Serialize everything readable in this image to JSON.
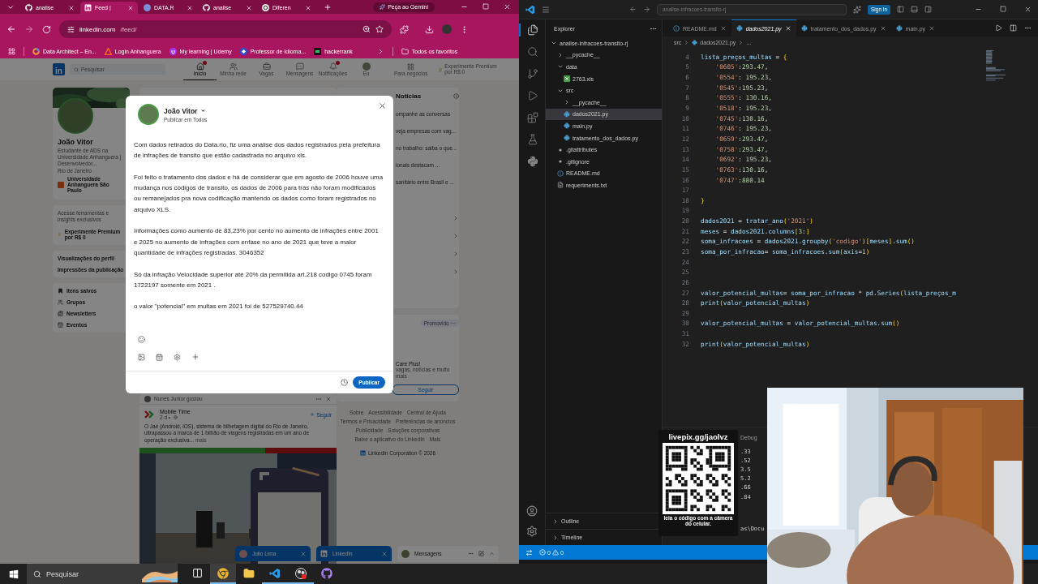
{
  "browser": {
    "tabs": [
      {
        "label": "analise",
        "kind": "github",
        "selected": false
      },
      {
        "label": "Feed |",
        "kind": "linkedin",
        "selected": true
      },
      {
        "label": "DATA.R",
        "kind": "data",
        "selected": false
      },
      {
        "label": "analise",
        "kind": "github",
        "selected": false
      },
      {
        "label": "Diferen",
        "kind": "chat",
        "selected": false
      }
    ],
    "gemini": "Peça ao Gemini",
    "url": {
      "host": "linkedin.com",
      "path": "/feed/"
    },
    "bookmarks": [
      {
        "label": "Data Architect – En...",
        "kind": "ring"
      },
      {
        "label": "Login Anhanguera",
        "kind": "triangle"
      },
      {
        "label": "My learning | Udemy",
        "kind": "badge"
      },
      {
        "label": "Professor de Idioma...",
        "kind": "diamond"
      },
      {
        "label": "hackerrank",
        "kind": "square"
      }
    ],
    "all_bookmarks": "Todos os favoritos"
  },
  "linkedin": {
    "logo": "in",
    "search": {
      "placeholder": "Pesquisar"
    },
    "nav": [
      {
        "label": "Início",
        "kind": "home",
        "selected": true,
        "alert": true
      },
      {
        "label": "Minha rede",
        "kind": "network",
        "selected": false,
        "alert": false
      },
      {
        "label": "Vagas",
        "kind": "jobs",
        "selected": false,
        "alert": false
      },
      {
        "label": "Mensagens",
        "kind": "messaging",
        "selected": false,
        "alert": false
      },
      {
        "label": "Notificações",
        "kind": "notifications",
        "selected": false,
        "alert": true
      },
      {
        "label": "Eu",
        "kind": "me",
        "selected": false,
        "alert": false
      }
    ],
    "business": "Para negócios",
    "premium_link": "Experimente Premium por R$ 0",
    "profile": {
      "name": "João Vitor",
      "headline": "Estudante de ADS na Universidade Anhanguera | Desenvolvedor...",
      "location": "Rio de Janeiro",
      "school": "Universidade Anhanguera São Paulo"
    },
    "premium_card": {
      "note": "Acesse ferramentas e insights exclusivos",
      "offer": "Experimente Premium por R$ 0"
    },
    "stats": [
      "Visualizações do perfil",
      "Impressões da publicação"
    ],
    "shortcuts": [
      {
        "label": "Itens salvos",
        "kind": "bookmark"
      },
      {
        "label": "Grupos",
        "kind": "groups"
      },
      {
        "label": "Newsletters",
        "kind": "newsletter"
      },
      {
        "label": "Eventos",
        "kind": "calendar"
      }
    ],
    "news": {
      "title": "Notícias",
      "items": [
        "ompanhe as conversas",
        "veja empresas com vag...",
        "no trabalho: saiba o que...",
        "ionais destacam ...",
        "sanitário entre Brasil e ..."
      ]
    },
    "ad": {
      "label": "Promovido ···",
      "title": "Care Plus!",
      "text": "vagas, notícias e muito mais",
      "button": "Seguir"
    },
    "footer": [
      "Sobre",
      "Acessibilidade",
      "Central de Ajuda",
      "Termos e Privacidade",
      "Preferências de anúncios",
      "Publicidade",
      "Soluções corporativas",
      "Baixe o aplicativo do LinkedIn",
      "Mais"
    ],
    "copyright": "LinkedIn Corporation © 2026",
    "post": {
      "activity": "Nunes Junior gostou",
      "author": "Mobile Time",
      "age": "2 d •",
      "follow": "Seguir",
      "text": "O Jaé (Android, iOS), sistema de bilhetagem digital do Rio de Janeiro, ultrapassou a marca de 1 bilhão de viagens registradas em um ano de operação exclusiva...",
      "more": "mais"
    },
    "chats": [
      {
        "name": "Julio Lima",
        "kind": "person"
      },
      {
        "name": "LinkedIn",
        "kind": "page"
      }
    ],
    "messaging": "Mensagens"
  },
  "dialog": {
    "author": "João Vitor",
    "audience": "Publicar em Todos",
    "paragraphs": [
      "Com dados retirados do Data.rio, fiz uma análise dos dados registrados pela prefeitura de infrações de transito que estão cadastrada no arquivo xls.",
      "Foi feito o tratamento dos dados e há de considerar que em agosto de 2006 houve uma mudança nos códigos de transito, os dados de 2006 para trás não foram modificados ou remanejados pra nova codificação mantendo os dados como foram registrados no arquivo XLS.",
      "Informações como aumento de 83,23% por cento no aumento  de infrações entre 2001 e 2025 no aumento de infrações com enfase no ano de 2021 que teve a maior quantidade de infrações registradas. 3046352",
      "Só da infração Velocidade superior até 20% da permitida art.218 codigo 0745 foram 1722197 somente em 2021 .",
      "o valor \"potencial\" em multas em 2021 foi de 527529740.44"
    ],
    "publish": "Publicar"
  },
  "vscode": {
    "title": "analise-infracoes-transito-rj",
    "sign_in": "Sign In",
    "activity": [
      {
        "kind": "explorer",
        "selected": true
      },
      {
        "kind": "search",
        "selected": false
      },
      {
        "kind": "scm",
        "selected": false
      },
      {
        "kind": "run",
        "selected": false
      },
      {
        "kind": "extensions",
        "selected": false
      },
      {
        "kind": "testing",
        "selected": false
      },
      {
        "kind": "python",
        "selected": false
      }
    ],
    "explorer": {
      "title": "Explorer",
      "tree": [
        {
          "label": "analise-infracoes-transito-rj",
          "kind": "folder",
          "expanded": true,
          "selected": false,
          "children": [
            {
              "label": "__pycache__",
              "kind": "folder",
              "expanded": false,
              "selected": false
            },
            {
              "label": "data",
              "kind": "folder",
              "expanded": true,
              "selected": false,
              "children": [
                {
                  "label": "2763.xls",
                  "kind": "excel",
                  "selected": false
                }
              ]
            },
            {
              "label": "src",
              "kind": "folder",
              "expanded": true,
              "selected": false,
              "children": [
                {
                  "label": "__pycache__",
                  "kind": "folder",
                  "expanded": false,
                  "selected": false
                },
                {
                  "label": "dados2021.py",
                  "kind": "python",
                  "selected": true
                },
                {
                  "label": "main.py",
                  "kind": "python",
                  "selected": false
                },
                {
                  "label": "tratamento_dos_dados.py",
                  "kind": "python",
                  "selected": false
                }
              ]
            },
            {
              "label": ".gitattributes",
              "kind": "git",
              "selected": false
            },
            {
              "label": ".gitignore",
              "kind": "git",
              "selected": false
            },
            {
              "label": "README.md",
              "kind": "info",
              "selected": false
            },
            {
              "label": "requeriments.txt",
              "kind": "text",
              "selected": false
            }
          ]
        }
      ]
    },
    "sections": [
      "Outline",
      "Timeline"
    ],
    "tabs": [
      {
        "label": "README.md",
        "kind": "info",
        "selected": false
      },
      {
        "label": "dados2021.py",
        "kind": "python",
        "selected": true
      },
      {
        "label": "tratamento_dos_dados.py",
        "kind": "python",
        "selected": false
      },
      {
        "label": "main.py",
        "kind": "python",
        "selected": false
      }
    ],
    "breadcrumb": [
      "src",
      "dados2021.py",
      "..."
    ],
    "code": [
      {
        "n": "4",
        "text": "lista_preços_multas = {"
      },
      {
        "n": "5",
        "text": "    '0605':293.47,"
      },
      {
        "n": "6",
        "text": "    '0554': 195.23,"
      },
      {
        "n": "7",
        "text": "    '0545':195.23,"
      },
      {
        "n": "8",
        "text": "    '0555': 130.16,"
      },
      {
        "n": "9",
        "text": "    '0518': 195.23,"
      },
      {
        "n": "10",
        "text": "    '0745':130.16,"
      },
      {
        "n": "11",
        "text": "    '0746': 195.23,"
      },
      {
        "n": "12",
        "text": "    '0659':293.47,"
      },
      {
        "n": "13",
        "text": "    '0758':293.47,"
      },
      {
        "n": "14",
        "text": "    '0692': 195.23,"
      },
      {
        "n": "15",
        "text": "    '0763':130.16,"
      },
      {
        "n": "16",
        "text": "    '0747':880.14"
      },
      {
        "n": "17"
      },
      {
        "n": "18",
        "text": "}"
      },
      {
        "n": "19"
      },
      {
        "n": "20",
        "text": "dados2021 = tratar_ano('2021')"
      },
      {
        "n": "21",
        "text": "meses = dados2021.columns[3:]"
      },
      {
        "n": "22",
        "text": "soma_infracoes = dados2021.groupby('codigo')[meses].sum()"
      },
      {
        "n": "23",
        "text": "soma_por_infracao= soma_infracoes.sum(axis=1)"
      },
      {
        "n": "24"
      },
      {
        "n": "25"
      },
      {
        "n": "26"
      },
      {
        "n": "27",
        "text": "valor_potencial_multas= soma_por_infracao * pd.Series(lista_preços_m"
      },
      {
        "n": "28",
        "text": "print(valor_potencial_multas)"
      },
      {
        "n": "29"
      },
      {
        "n": "30",
        "text": "valor_potencial_multas = valor_potencial_multas.sum()"
      },
      {
        "n": "31"
      },
      {
        "n": "32",
        "text": "print(valor_potencial_multas)"
      }
    ],
    "panel": {
      "tab": "Debug",
      "lines": [
        ".33",
        ".52",
        "3.5",
        "5.2",
        ".66",
        ".84"
      ],
      "path": "as\\Docu"
    },
    "status": {
      "errors": "0",
      "warnings": "0"
    }
  },
  "overlay": {
    "qr_url": "livepix.gg/jaolvz",
    "qr_hint": "leia o código com a câmera do celular."
  },
  "taskbar": {
    "search": {
      "placeholder": "Pesquisar"
    },
    "apps": [
      {
        "kind": "taskview",
        "selected": false,
        "running": false
      },
      {
        "kind": "chrome",
        "selected": true,
        "running": true
      },
      {
        "kind": "files",
        "selected": false,
        "running": false
      },
      {
        "kind": "vscode",
        "selected": false,
        "running": true
      },
      {
        "kind": "obs",
        "selected": false,
        "running": true
      },
      {
        "kind": "github",
        "selected": false,
        "running": false
      }
    ]
  }
}
